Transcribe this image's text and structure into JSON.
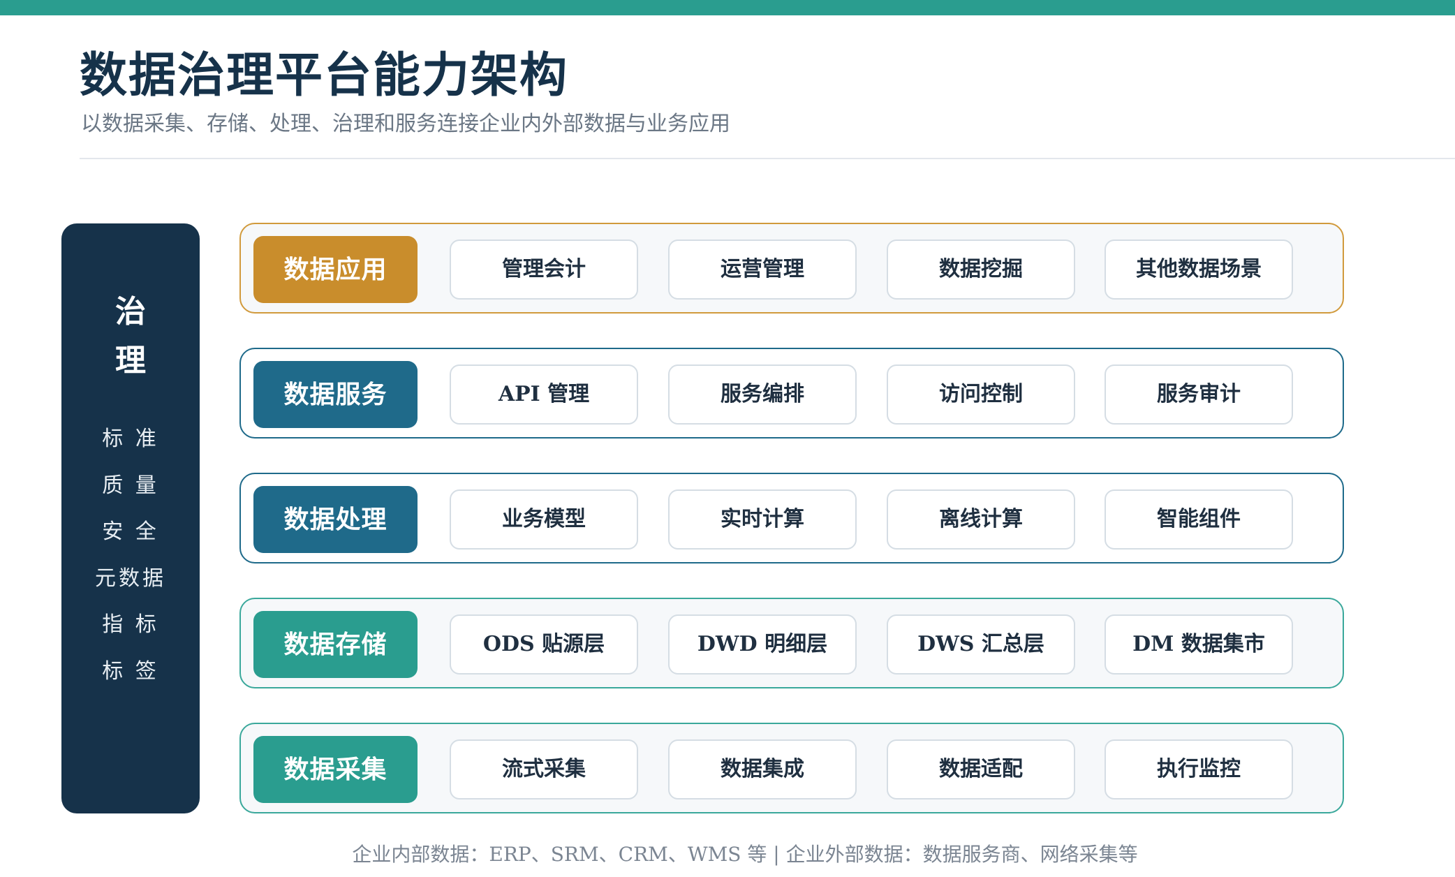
{
  "header": {
    "title": "数据治理平台能力架构",
    "subtitle": "以数据采集、存储、处理、治理和服务连接企业内外部数据与业务应用"
  },
  "governance": {
    "title_chars": [
      "治",
      "理"
    ],
    "items": [
      "标 准",
      "质 量",
      "安 全",
      "元数据",
      "指 标",
      "标 签"
    ]
  },
  "layers": [
    {
      "label": "数据应用",
      "items": [
        "管理会计",
        "运营管理",
        "数据挖掘",
        "其他数据场景"
      ]
    },
    {
      "label": "数据服务",
      "items": [
        "API 管理",
        "服务编排",
        "访问控制",
        "服务审计"
      ]
    },
    {
      "label": "数据处理",
      "items": [
        "业务模型",
        "实时计算",
        "离线计算",
        "智能组件"
      ]
    },
    {
      "label": "数据存储",
      "items": [
        "ODS 贴源层",
        "DWD 明细层",
        "DWS 汇总层",
        "DM 数据集市"
      ]
    },
    {
      "label": "数据采集",
      "items": [
        "流式采集",
        "数据集成",
        "数据适配",
        "执行监控"
      ]
    }
  ],
  "footer": {
    "note": "企业内部数据：ERP、SRM、CRM、WMS 等 | 企业外部数据：数据服务商、网络采集等"
  },
  "colors": {
    "navy": "#16324a",
    "gold": "#c98d2c",
    "blue": "#1f6a8a",
    "teal": "#2a9d8f"
  }
}
